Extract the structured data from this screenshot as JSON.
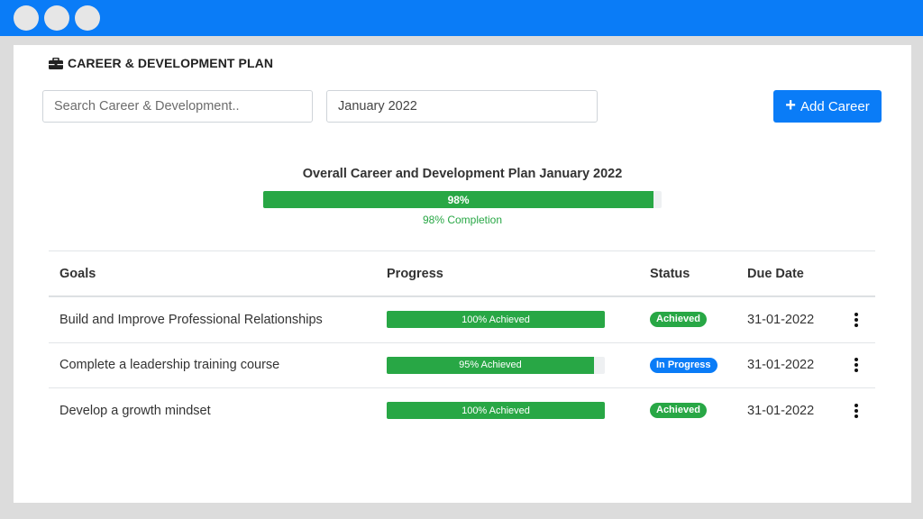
{
  "window": {
    "controls": [
      "close",
      "minimize",
      "maximize"
    ]
  },
  "page": {
    "title": "CAREER & DEVELOPMENT PLAN",
    "title_icon": "briefcase-icon"
  },
  "filters": {
    "search_placeholder": "Search Career & Development..",
    "month_value": "January 2022"
  },
  "actions": {
    "add_label": "Add Career",
    "add_icon": "plus-icon"
  },
  "overall": {
    "title": "Overall Career and Development Plan January 2022",
    "percent": 98,
    "bar_label": "98%",
    "caption": "98% Completion"
  },
  "table": {
    "headers": {
      "goals": "Goals",
      "progress": "Progress",
      "status": "Status",
      "due": "Due Date"
    },
    "rows": [
      {
        "goal": "Build and Improve Professional Relationships",
        "progress": 100,
        "progress_label": "100% Achieved",
        "status": "Achieved",
        "status_color": "#28a745",
        "due": "31-01-2022"
      },
      {
        "goal": "Complete a leadership training course",
        "progress": 95,
        "progress_label": "95% Achieved",
        "status": "In Progress",
        "status_color": "#0a7cf7",
        "due": "31-01-2022"
      },
      {
        "goal": "Develop a growth mindset",
        "progress": 100,
        "progress_label": "100% Achieved",
        "status": "Achieved",
        "status_color": "#28a745",
        "due": "31-01-2022"
      }
    ]
  },
  "colors": {
    "accent": "#0a7cf7",
    "success": "#28a745"
  }
}
